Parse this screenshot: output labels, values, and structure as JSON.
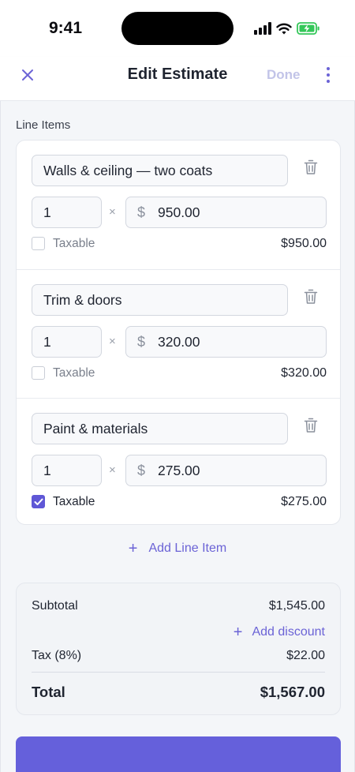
{
  "status": {
    "time": "9:41",
    "icons": [
      "cellular-signal-icon",
      "wifi-icon",
      "battery-charging-icon"
    ]
  },
  "nav": {
    "title": "Edit Estimate",
    "done_label": "Done",
    "close_icon": "close-icon",
    "more_icon": "more-vertical-icon"
  },
  "line_items_label": "Line Items",
  "line_items": [
    {
      "description": "Walls & ceiling — two coats",
      "qty": "1",
      "times": "×",
      "currency": "$",
      "price": "950.00",
      "taxable_label": "Taxable",
      "taxable": false,
      "total": "$950.00"
    },
    {
      "description": "Trim & doors",
      "qty": "1",
      "times": "×",
      "currency": "$",
      "price": "320.00",
      "taxable_label": "Taxable",
      "taxable": false,
      "total": "$320.00"
    },
    {
      "description": "Paint & materials",
      "qty": "1",
      "times": "×",
      "currency": "$",
      "price": "275.00",
      "taxable_label": "Taxable",
      "taxable": true,
      "total": "$275.00"
    }
  ],
  "add_line_item": {
    "plus": "+",
    "label": "Add Line Item"
  },
  "totals": {
    "subtotal_label": "Subtotal",
    "subtotal_value": "$1,545.00",
    "add_discount_plus": "+",
    "add_discount_label": "Add discount",
    "tax_label": "Tax (8%)",
    "tax_value": "$22.00",
    "total_label": "Total",
    "total_value": "$1,567.00"
  },
  "colors": {
    "accent": "#6b63d6",
    "done_disabled": "#c2c4e8",
    "battery": "#34c759",
    "background": "#f4f6f9"
  }
}
